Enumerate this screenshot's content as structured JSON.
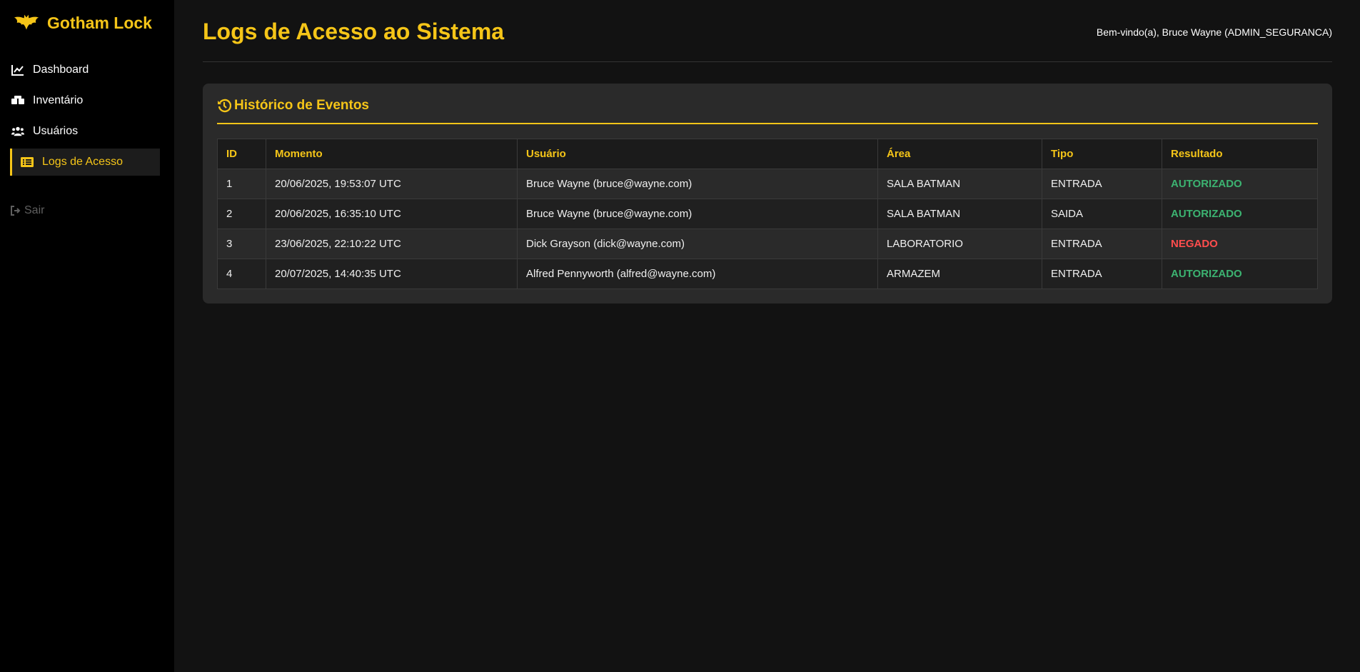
{
  "brand": {
    "name": "Gotham Lock",
    "accent_color": "#f5c518"
  },
  "sidebar": {
    "items": [
      {
        "label": "Dashboard",
        "icon": "chart-line-icon"
      },
      {
        "label": "Inventário",
        "icon": "boxes-icon"
      },
      {
        "label": "Usuários",
        "icon": "users-icon"
      },
      {
        "label": "Logs de Acesso",
        "icon": "list-icon",
        "active": true
      }
    ],
    "logout_label": "Sair"
  },
  "header": {
    "title": "Logs de Acesso ao Sistema",
    "welcome": "Bem-vindo(a), Bruce Wayne (ADMIN_SEGURANCA)"
  },
  "card": {
    "title": "Histórico de Eventos"
  },
  "table": {
    "columns": [
      "ID",
      "Momento",
      "Usuário",
      "Área",
      "Tipo",
      "Resultado"
    ],
    "rows": [
      {
        "id": "1",
        "momento": "20/06/2025, 19:53:07 UTC",
        "usuario": "Bruce Wayne (bruce@wayne.com)",
        "area": "SALA BATMAN",
        "tipo": "ENTRADA",
        "resultado": "AUTORIZADO"
      },
      {
        "id": "2",
        "momento": "20/06/2025, 16:35:10 UTC",
        "usuario": "Bruce Wayne (bruce@wayne.com)",
        "area": "SALA BATMAN",
        "tipo": "SAIDA",
        "resultado": "AUTORIZADO"
      },
      {
        "id": "3",
        "momento": "23/06/2025, 22:10:22 UTC",
        "usuario": "Dick Grayson (dick@wayne.com)",
        "area": "LABORATORIO",
        "tipo": "ENTRADA",
        "resultado": "NEGADO"
      },
      {
        "id": "4",
        "momento": "20/07/2025, 14:40:35 UTC",
        "usuario": "Alfred Pennyworth (alfred@wayne.com)",
        "area": "ARMAZEM",
        "tipo": "ENTRADA",
        "resultado": "AUTORIZADO"
      }
    ]
  },
  "colors": {
    "authorized": "#3cb371",
    "denied": "#ff4d4d"
  }
}
